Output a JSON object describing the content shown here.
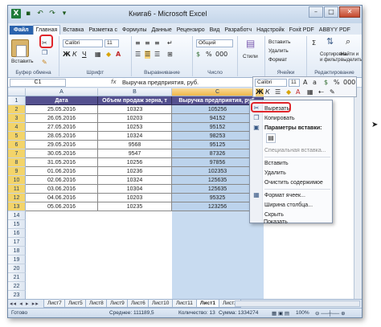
{
  "title": "Книга6 - Microsoft Excel",
  "ribbon_tabs": [
    "Файл",
    "Главная",
    "Вставка",
    "Разметка с",
    "Формулы",
    "Данные",
    "Рецензиро",
    "Вид",
    "Разработч",
    "Надстройк",
    "Foxit PDF",
    "ABBYY PDF"
  ],
  "ribbon": {
    "paste_label": "Вставить",
    "font_name": "Calibri",
    "font_size": "11",
    "number_format": "Общий",
    "styles_label": "Стили",
    "insert_label": "Вставить",
    "delete_label": "Удалить",
    "format_label": "Формат",
    "sort_label": "Сортировка и фильтр",
    "find_label": "Найти и выделить",
    "groups": [
      "Буфер обмена",
      "Шрифт",
      "Выравнивание",
      "Число",
      "Ячейки",
      "Редактирование"
    ]
  },
  "formula_bar": {
    "cell_ref": "C1",
    "fx": "fx",
    "content": "Выручка предприятия, руб."
  },
  "columns": [
    "A",
    "B",
    "C",
    "D"
  ],
  "rows": [
    "1",
    "2",
    "3",
    "4",
    "5",
    "6",
    "7",
    "8",
    "9",
    "10",
    "11",
    "12",
    "13",
    "14",
    "15",
    "16",
    "17",
    "18",
    "19",
    "20",
    "21",
    "22",
    "23"
  ],
  "table": {
    "headers": [
      "Дата",
      "Объем продаж зерна, т",
      "Выручка предприятия, руб."
    ],
    "data": [
      [
        "25.05.2016",
        "10323",
        "105256"
      ],
      [
        "26.05.2016",
        "10203",
        "94152"
      ],
      [
        "27.05.2016",
        "10253",
        "95152"
      ],
      [
        "28.05.2016",
        "10324",
        "98253"
      ],
      [
        "29.05.2016",
        "9568",
        "95125"
      ],
      [
        "30.05.2016",
        "9547",
        "87326"
      ],
      [
        "31.05.2016",
        "10256",
        "97856"
      ],
      [
        "01.06.2016",
        "10236",
        "102353"
      ],
      [
        "02.06.2016",
        "10324",
        "125635"
      ],
      [
        "03.06.2016",
        "10304",
        "125635"
      ],
      [
        "04.06.2016",
        "10203",
        "95325"
      ],
      [
        "05.06.2016",
        "10235",
        "123256"
      ]
    ]
  },
  "mini_toolbar": {
    "font": "Calibri",
    "size": "11"
  },
  "context_menu": {
    "cut": "Вырезать",
    "copy": "Копировать",
    "paste_options": "Параметры вставки:",
    "paste_special": "Специальная вставка...",
    "insert": "Вставить",
    "delete": "Удалить",
    "clear": "Очистить содержимое",
    "format_cells": "Формат ячеек...",
    "col_width": "Ширина столбца...",
    "hide": "Скрыть",
    "show": "Показать"
  },
  "sheet_tabs": [
    "Лист7",
    "Лист5",
    "Лист8",
    "Лист9",
    "Лист6",
    "Лист10",
    "Лист11",
    "Лист1",
    "Лист2"
  ],
  "active_sheet": "Лист1",
  "status": {
    "ready": "Готово",
    "average": "Среднее: 111189,5",
    "count": "Количество: 13",
    "sum": "Сумма: 1334274",
    "zoom": "100%"
  },
  "colors": {
    "header_fill": "#54508f",
    "selection": "#c8dbf0",
    "highlight_ring": "#e0262b"
  }
}
